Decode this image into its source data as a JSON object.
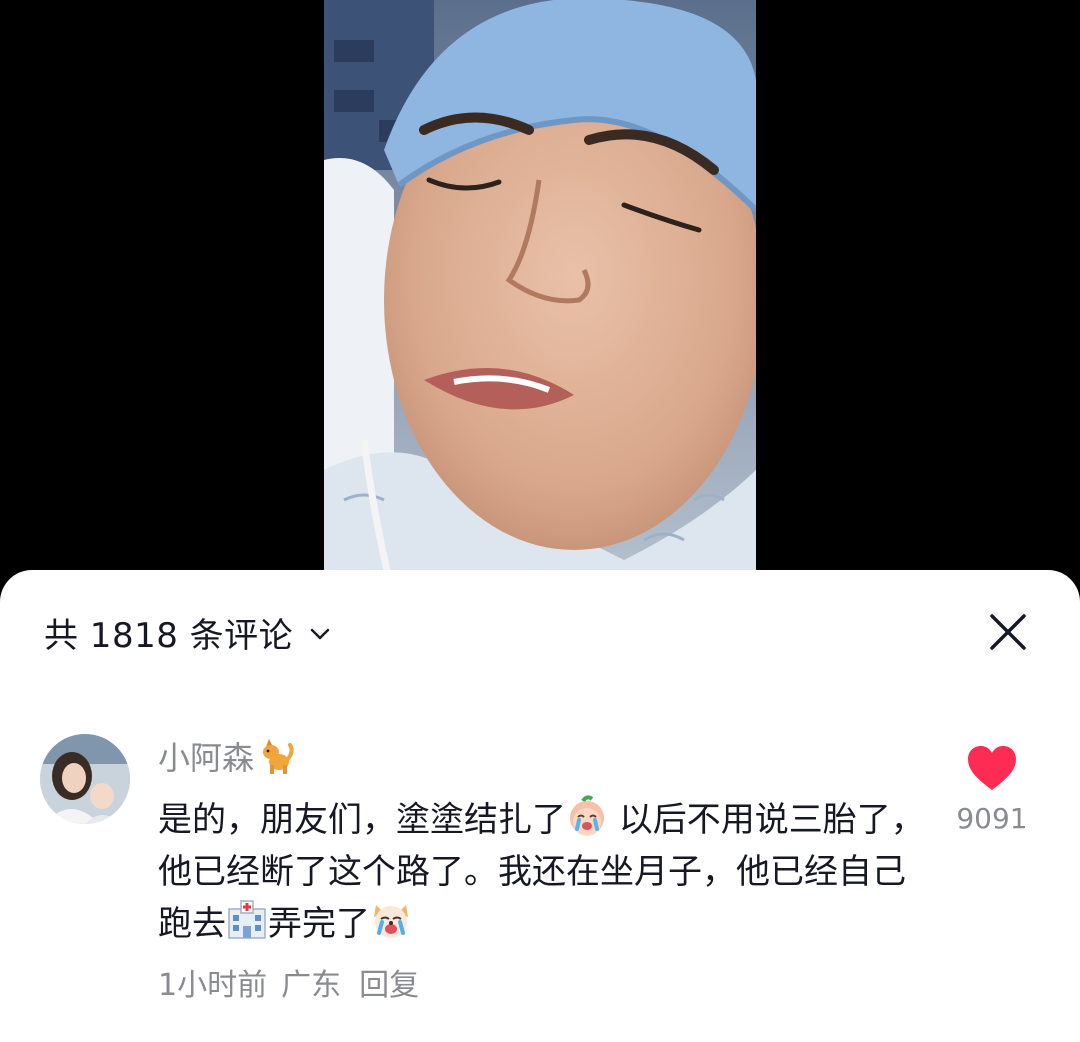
{
  "header": {
    "comment_count_label": "共 1818 条评论"
  },
  "comment": {
    "username": "小阿森",
    "username_badge_icon": "cat-emoji-icon",
    "text_parts": [
      "是的，朋友们，塗塗结扎了",
      " 以后不用说三胎了，他已经断了这个路了。我还在坐月子，他已经自己跑去",
      "弄完了"
    ],
    "emoji_icons": [
      "crying-peach-emoji-icon",
      "hospital-emoji-icon",
      "crying-dog-emoji-icon"
    ],
    "time": "1小时前",
    "location": "广东",
    "reply_label": "回复",
    "like_count": "9091",
    "liked": true
  },
  "colors": {
    "like_red": "#fe2c55",
    "meta_gray": "#8a8b91",
    "text_dark": "#161823",
    "sheet_bg": "#ffffff"
  }
}
